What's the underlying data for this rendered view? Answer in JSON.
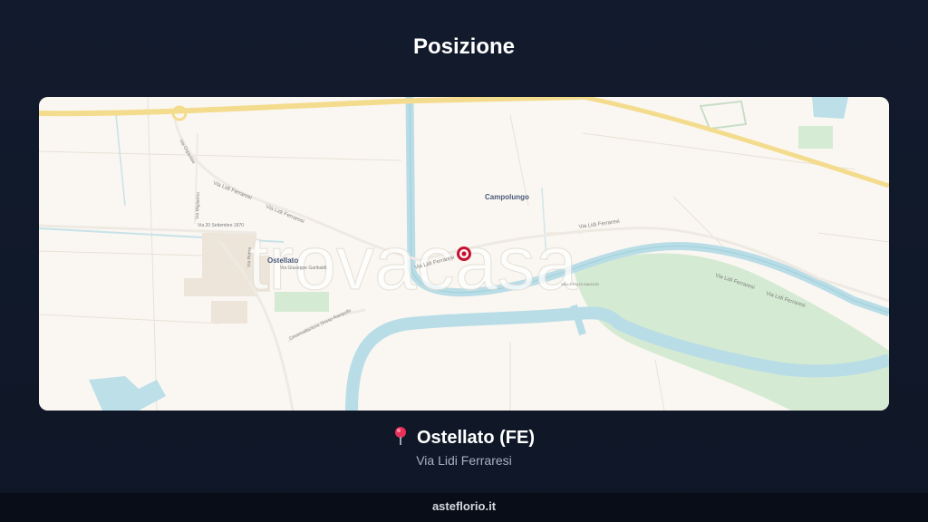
{
  "header": {
    "title": "Posizione"
  },
  "map": {
    "watermark": "trovacasa",
    "labels": {
      "ostellato": "Ostellato",
      "campolungo": "Campolungo",
      "via_lidi_1": "Via Lidi Ferraresi",
      "via_lidi_2": "Via Lidi Ferraresi",
      "via_lidi_3": "Via Lidi Ferraresi",
      "via_lidi_4": "Via Lidi Ferraresi",
      "via_lidi_5": "Via Lidi Ferraresi",
      "via_lidi_6": "Via Lidi Ferraresi",
      "via_garibaldi": "Via Giuseppe Garibaldi",
      "via_20_settembre": "Via 20 Settembre 1870",
      "via_migliarino": "Via Migliarino",
      "via_ospedale": "Via Ospedale",
      "via_roma": "Via Roma",
      "circonvallazione": "Circonvallazione Dosso Rampollo",
      "valletta": "VALLETTA DI MAGGIO"
    },
    "colors": {
      "marker": "#c8102e",
      "water": "#b9dde6",
      "green": "#d4ead2",
      "road": "#f4dc8e"
    }
  },
  "location": {
    "city": "Ostellato (FE)",
    "address": "Via Lidi Ferraresi"
  },
  "footer": {
    "site": "asteflorio.it"
  }
}
